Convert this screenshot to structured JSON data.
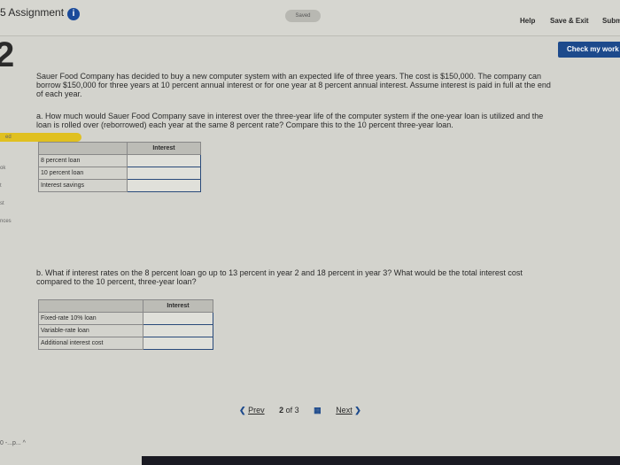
{
  "header": {
    "title": "5 Assignment",
    "saved": "Saved",
    "help": "Help",
    "save_exit": "Save & Exit",
    "submit": "Subm"
  },
  "check_work": "Check my work",
  "question_number": "2",
  "sidebar": [
    "ed",
    "ok",
    "t",
    "st",
    "nces"
  ],
  "intro": "Sauer Food Company has decided to buy a new computer system with an expected life of three years. The cost is $150,000. The company can borrow $150,000 for three years at 10 percent annual interest or for one year at 8 percent annual interest. Assume interest is paid in full at the end of each year.",
  "part_a": {
    "question": "a. How much would Sauer Food Company save in interest over the three-year life of the computer system if the one-year loan is utilized and the loan is rolled over (reborrowed) each year at the same 8 percent rate? Compare this to the 10 percent three-year loan.",
    "header": "Interest",
    "rows": [
      "8 percent loan",
      "10 percent loan",
      "Interest savings"
    ]
  },
  "part_b": {
    "question": "b. What if interest rates on the 8 percent loan go up to 13 percent in year 2 and 18 percent in year 3? What would be the total interest cost compared to the 10 percent, three-year loan?",
    "header": "Interest",
    "rows": [
      "Fixed-rate 10% loan",
      "Variable-rate loan",
      "Additional interest cost"
    ]
  },
  "pager": {
    "prev": "Prev",
    "current": "2",
    "of": "of 3",
    "next": "Next"
  },
  "bottom_text": "0 -...p...  ^"
}
